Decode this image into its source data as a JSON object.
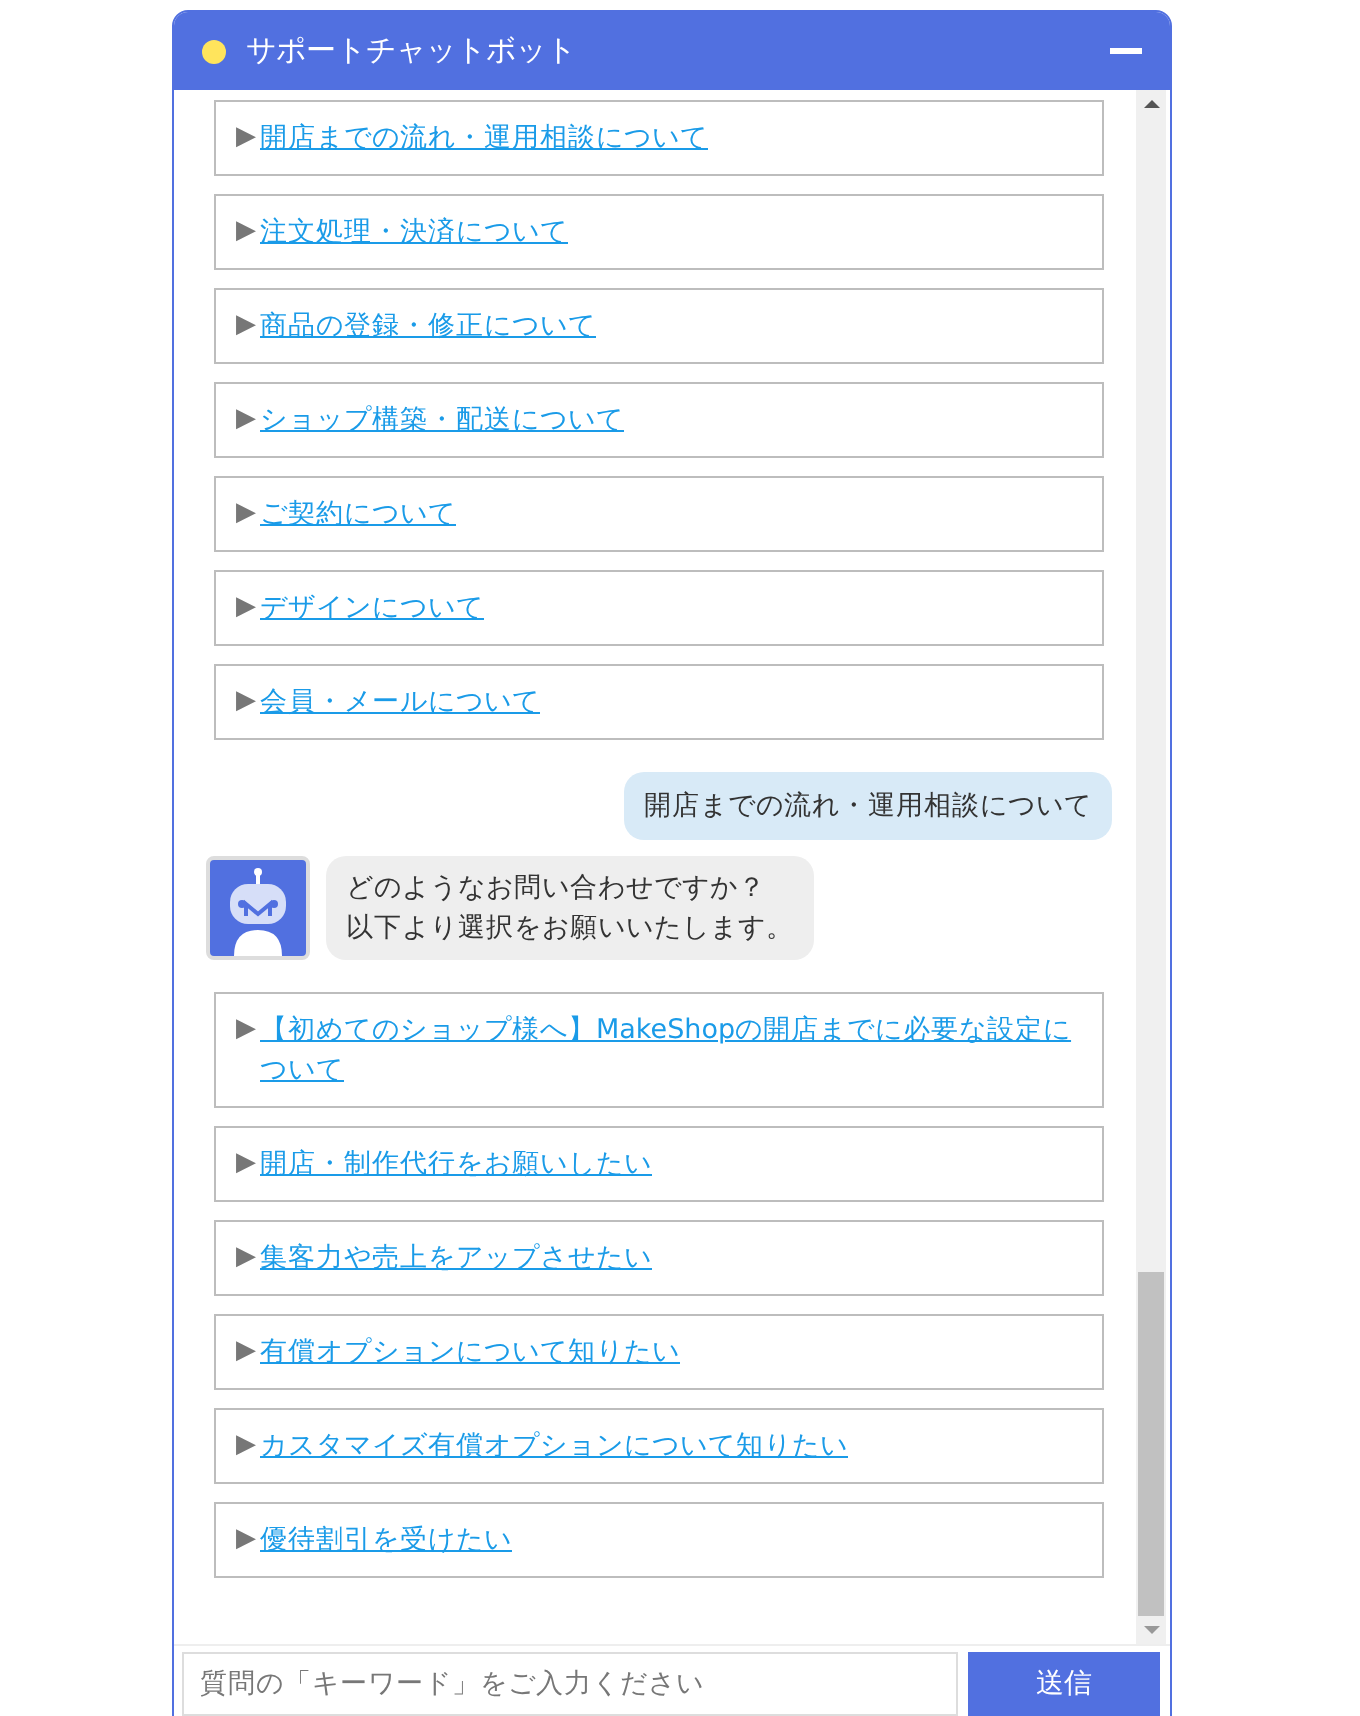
{
  "window": {
    "title": "サポートチャットボット"
  },
  "messages": [
    {
      "kind": "options",
      "options": [
        {
          "marker": "▶",
          "label": "開店までの流れ・運用相談について"
        },
        {
          "marker": "▶",
          "label": "注文処理・決済について"
        },
        {
          "marker": "▶",
          "label": "商品の登録・修正について"
        },
        {
          "marker": "▶",
          "label": "ショップ構築・配送について"
        },
        {
          "marker": "▶",
          "label": "ご契約について"
        },
        {
          "marker": "▶",
          "label": "デザインについて"
        },
        {
          "marker": "▶",
          "label": "会員・メールについて"
        }
      ]
    },
    {
      "kind": "user",
      "text": "開店までの流れ・運用相談について"
    },
    {
      "kind": "bot",
      "lines": [
        "どのようなお問い合わせですか？",
        "以下より選択をお願いいたします。"
      ]
    },
    {
      "kind": "options",
      "options": [
        {
          "marker": "▶",
          "label": "【初めてのショップ様へ】MakeShopの開店までに必要な設定について"
        },
        {
          "marker": "▶",
          "label": "開店・制作代行をお願いしたい"
        },
        {
          "marker": "▶",
          "label": "集客力や売上をアップさせたい"
        },
        {
          "marker": "▶",
          "label": "有償オプションについて知りたい"
        },
        {
          "marker": "▶",
          "label": "カスタマイズ有償オプションについて知りたい"
        },
        {
          "marker": "▶",
          "label": "優待割引を受けたい"
        }
      ]
    }
  ],
  "input": {
    "placeholder": "質問の「キーワード」をご入力ください",
    "send_label": "送信"
  }
}
